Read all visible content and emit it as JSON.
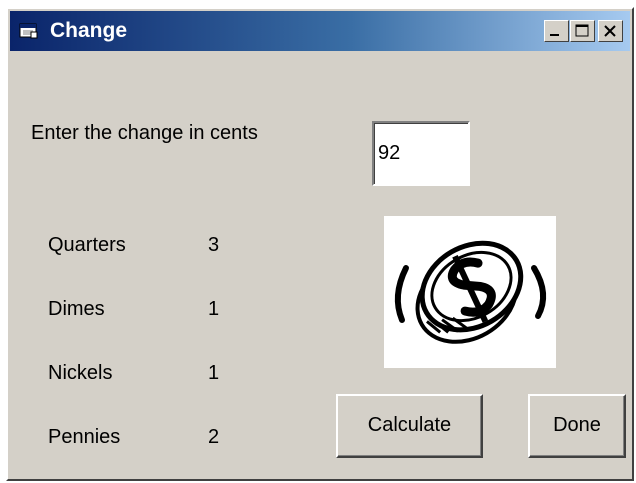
{
  "window": {
    "title": "Change"
  },
  "title_buttons": {
    "minimize": "minimize-icon",
    "maximize": "maximize-icon",
    "close": "close-icon"
  },
  "prompt": {
    "label": "Enter the change in cents"
  },
  "input": {
    "value": "92"
  },
  "results": [
    {
      "label": "Quarters",
      "value": "3"
    },
    {
      "label": "Dimes",
      "value": "1"
    },
    {
      "label": "Nickels",
      "value": "1"
    },
    {
      "label": "Pennies",
      "value": "2"
    }
  ],
  "image": {
    "icon": "dollar-coin-icon"
  },
  "buttons": {
    "calculate": "Calculate",
    "done": "Done"
  },
  "colors": {
    "titlebar_start": "#0a246a",
    "titlebar_end": "#a6caf0",
    "face": "#d4d0c8"
  }
}
